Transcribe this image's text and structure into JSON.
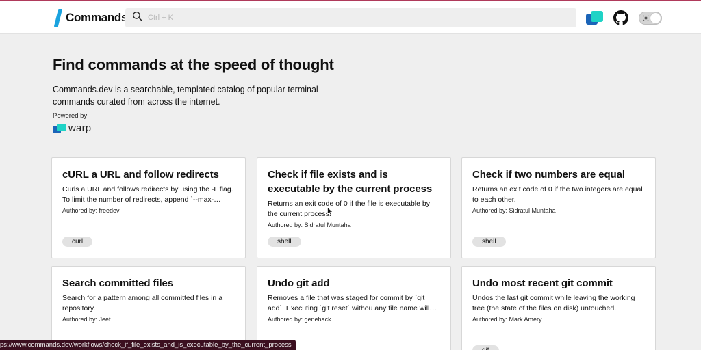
{
  "brand": {
    "name": "Commands",
    "accent": "#1aa3df"
  },
  "search": {
    "placeholder": "Ctrl + K"
  },
  "header": {
    "warp_icon": "warp-logo-icon",
    "github_icon": "github-icon",
    "theme_toggle_icon": "sun-icon"
  },
  "hero": {
    "title": "Find commands at the speed of thought",
    "description": "Commands.dev is a searchable, templated catalog of popular terminal commands curated from across the internet.",
    "powered_by": "Powered by",
    "sponsor": "warp"
  },
  "cards": [
    {
      "title": "cURL a URL and follow redirects",
      "description": "Curls a URL and follows redirects by using the -L flag. To limit the number of redirects, append `--max-redirs`.",
      "author": "Authored by: freedev",
      "tag": "curl"
    },
    {
      "title": "Check if file exists and is executable by the current process",
      "description": "Returns an exit code of 0 if the file is executable by the current process.",
      "author": "Authored by: Sidratul Muntaha",
      "tag": "shell"
    },
    {
      "title": "Check if two numbers are equal",
      "description": "Returns an exit code of 0 if the two integers are equal to each other.",
      "author": "Authored by: Sidratul Muntaha",
      "tag": "shell"
    },
    {
      "title": "Search committed files",
      "description": "Search for a pattern among all committed files in a repository.",
      "author": "Authored by: Jeet",
      "tag": ""
    },
    {
      "title": "Undo git add",
      "description": "Removes a file that was staged for commit by `git add`. Executing `git reset` withou any file name will unstage all files.",
      "author": "Authored by: genehack",
      "tag": ""
    },
    {
      "title": "Undo most recent git commit",
      "description": "Undos the last git commit while leaving the working tree (the state of the files on disk) untouched.",
      "author": "Authored by: Mark Amery",
      "tag": "git"
    }
  ],
  "status_bar": {
    "url": "ps://www.commands.dev/workflows/check_if_file_exists_and_is_executable_by_the_current_process"
  }
}
